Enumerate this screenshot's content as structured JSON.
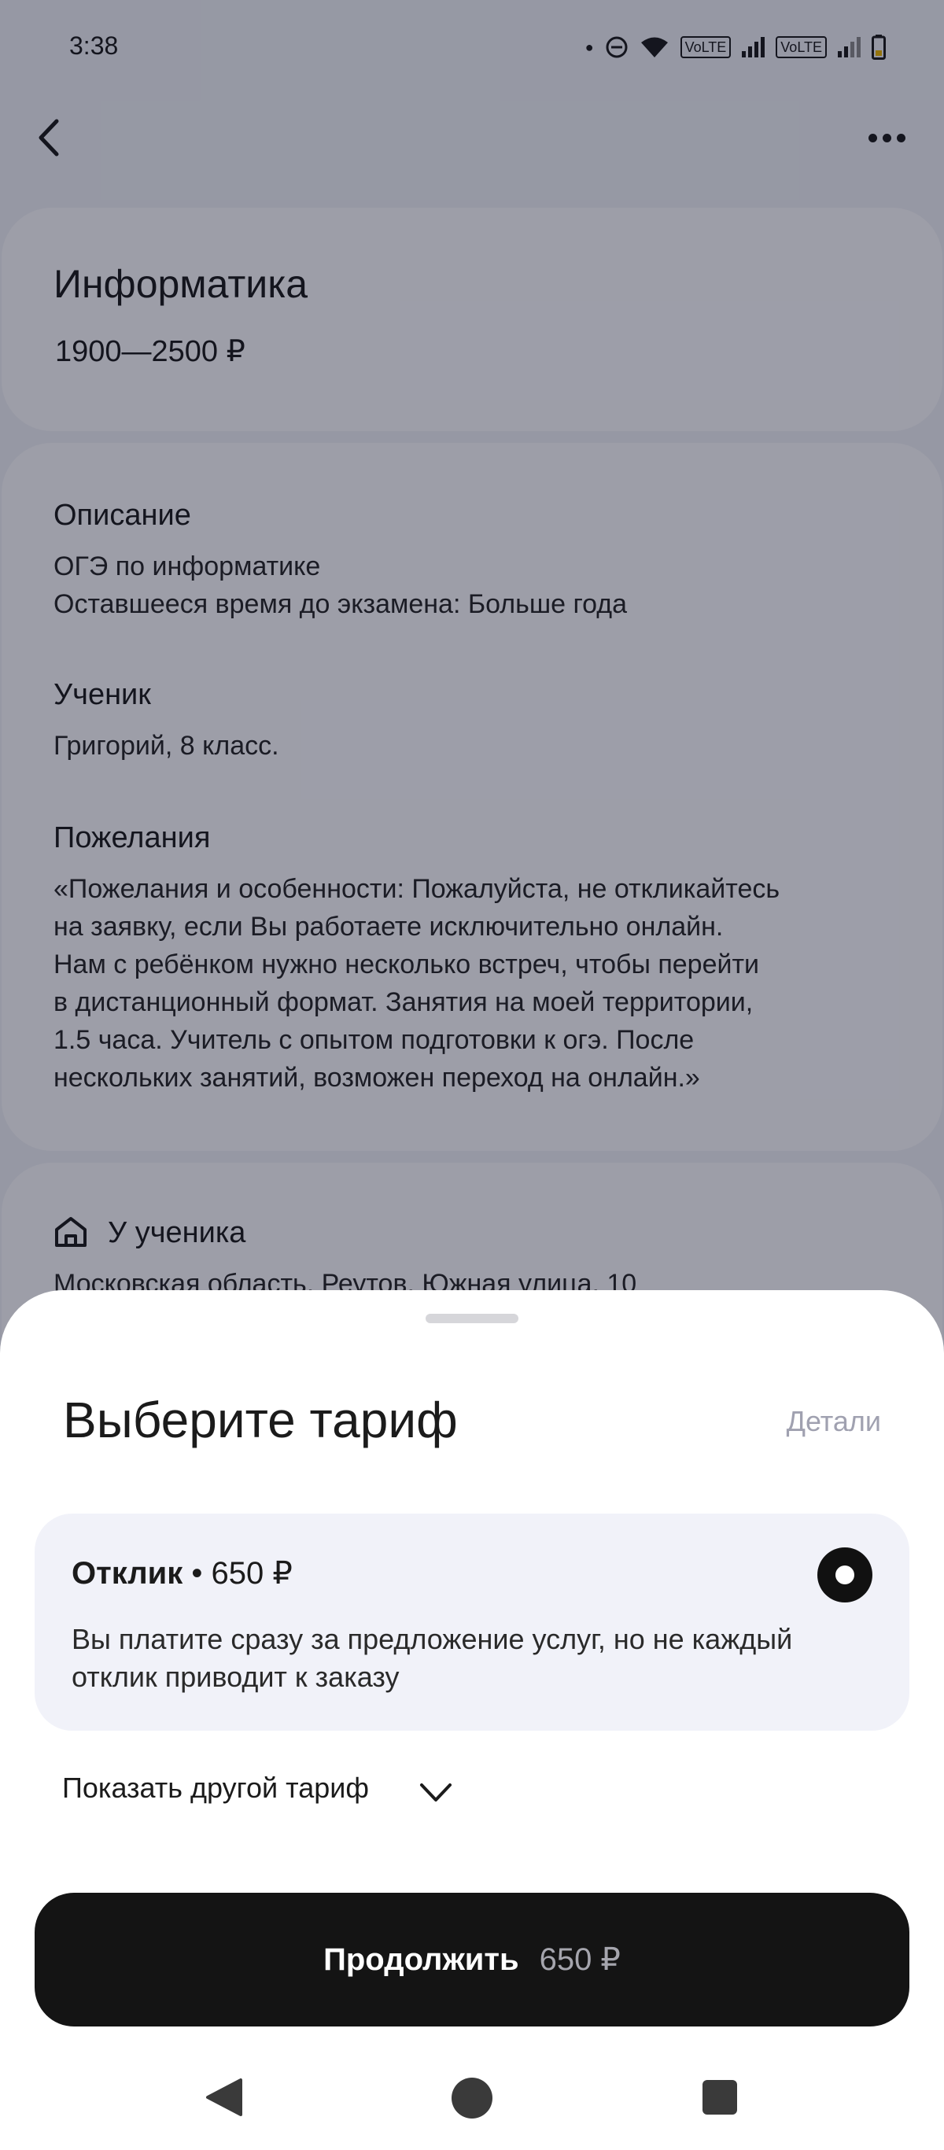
{
  "status_bar": {
    "time": "3:38",
    "volte_1": "VoLTE",
    "volte_2": "VoLTE",
    "icons": [
      "dot-icon",
      "do-not-disturb-icon",
      "wifi-icon",
      "signal-icon",
      "battery-icon"
    ]
  },
  "top_bar": {
    "back_icon": "chevron-left-icon",
    "menu_icon": "more-horizontal-icon"
  },
  "subject": {
    "title": "Информатика",
    "price_range": "1900—2500 ₽"
  },
  "details": {
    "description_heading": "Описание",
    "description_line1": "ОГЭ по информатике",
    "description_line2": "Оставшееся время до экзамена: Больше года",
    "student_heading": "Ученик",
    "student_text": "Григорий, 8 класс.",
    "wishes_heading": "Пожелания",
    "wishes_lines": [
      "«Пожелания и особенности: Пожалуйста, не откликайтесь",
      "на заявку, если Вы работаете исключительно онлайн.",
      "Нам с ребёнком нужно несколько встреч, чтобы перейти",
      "в дистанционный формат. Занятия на моей территории,",
      "1.5 часа. Учитель с опытом подготовки к огэ. После",
      "нескольких занятий, возможен переход на онлайн.»"
    ]
  },
  "location": {
    "icon": "home-icon",
    "heading": "У ученика",
    "address": "Московская область, Реутов, Южная улица, 10"
  },
  "sheet": {
    "title": "Выберите тариф",
    "details_link": "Детали",
    "tariff": {
      "name": "Отклик",
      "separator": " • ",
      "price": "650 ₽",
      "selected": true,
      "description_line1": "Вы платите сразу за предложение услуг, но не каждый",
      "description_line2": "отклик приводит к заказу"
    },
    "show_other": "Показать другой тариф",
    "continue_label": "Продолжить",
    "continue_price": "650 ₽"
  },
  "nav_bar": {
    "back_icon": "nav-back-icon",
    "home_icon": "nav-home-icon",
    "recents_icon": "nav-recents-icon"
  },
  "colors": {
    "overlay": "#0a0e26",
    "card_bg": "#f7f7f9",
    "tariff_bg": "#f1f2f9",
    "button_bg": "#141414",
    "link_muted": "#a0a1b0"
  }
}
